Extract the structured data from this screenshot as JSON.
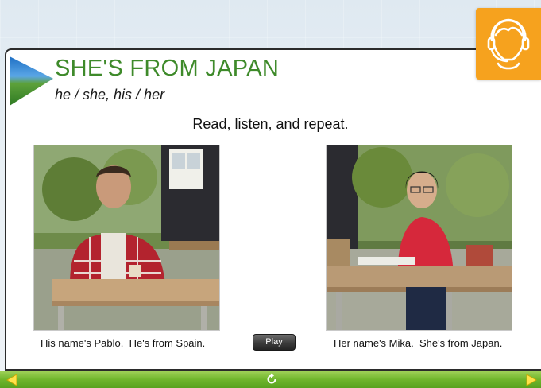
{
  "header": {
    "title": "SHE'S FROM JAPAN",
    "subtitle": "he / she, his / her",
    "instruction": "Read, listen, and repeat."
  },
  "assistant": {
    "icon": "headset-person-icon",
    "color": "#f6a21e"
  },
  "photos": [
    {
      "icon": "man-at-cafe-table-photo",
      "caption": "His name's Pablo.  He's from Spain."
    },
    {
      "icon": "woman-at-cafe-table-photo",
      "caption": "Her name's Mika.  She's from Japan."
    }
  ],
  "controls": {
    "play_label": "Play",
    "prev_icon": "triangle-left-icon",
    "next_icon": "triangle-right-icon",
    "replay_icon": "replay-icon"
  },
  "colors": {
    "title_green": "#3e8a2a",
    "bar_green": "#6fb52c",
    "accent_orange": "#f6a21e"
  }
}
